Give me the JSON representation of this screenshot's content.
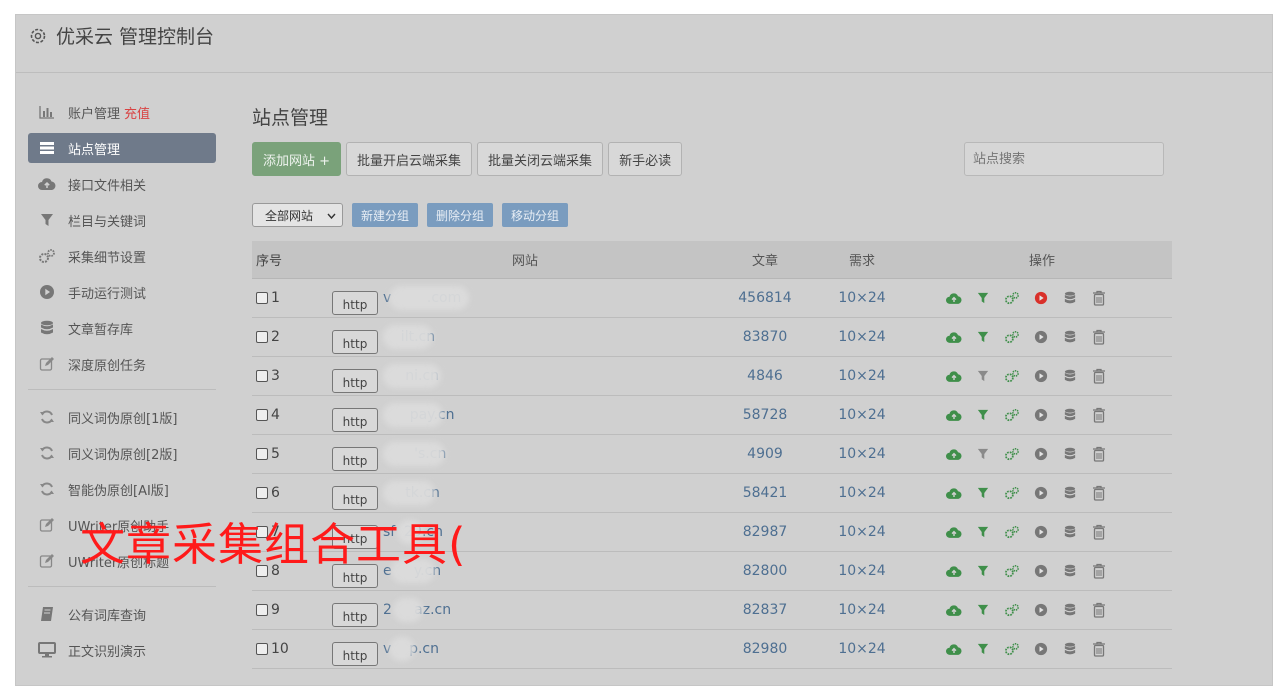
{
  "header": {
    "title": "优采云 管理控制台"
  },
  "sidebar": {
    "items": [
      {
        "label": "账户管理",
        "badge": "充值",
        "icon": "bar-chart-icon"
      },
      {
        "label": "站点管理",
        "icon": "list-icon",
        "active": true
      },
      {
        "label": "接口文件相关",
        "icon": "cloud-upload-icon"
      },
      {
        "label": "栏目与关键词",
        "icon": "filter-icon"
      },
      {
        "label": "采集细节设置",
        "icon": "gears-icon"
      },
      {
        "label": "手动运行测试",
        "icon": "play-circle-icon"
      },
      {
        "label": "文章暂存库",
        "icon": "database-icon"
      },
      {
        "label": "深度原创任务",
        "icon": "edit-icon"
      }
    ],
    "items2": [
      {
        "label": "同义词伪原创[1版]",
        "icon": "refresh-icon"
      },
      {
        "label": "同义词伪原创[2版]",
        "icon": "refresh-icon"
      },
      {
        "label": "智能伪原创[AI版]",
        "icon": "refresh-icon"
      },
      {
        "label": "UWriter原创助手",
        "icon": "edit-icon"
      },
      {
        "label": "UWriter原创标题",
        "icon": "edit-icon"
      }
    ],
    "items3": [
      {
        "label": "公有词库查询",
        "icon": "book-icon"
      },
      {
        "label": "正文识别演示",
        "icon": "monitor-icon"
      }
    ]
  },
  "main": {
    "title": "站点管理",
    "toolbar": {
      "add": "添加网站 +",
      "enable_all": "批量开启云端采集",
      "disable_all": "批量关闭云端采集",
      "guide": "新手必读"
    },
    "search_placeholder": "站点搜索",
    "group_select": "全部网站",
    "group_buttons": {
      "new": "新建分组",
      "delete": "删除分组",
      "move": "移动分组"
    },
    "table": {
      "headers": {
        "no": "序号",
        "site": "网站",
        "articles": "文章",
        "demand": "需求",
        "ops": "操作"
      },
      "rows": [
        {
          "no": "1",
          "scheme": "http",
          "host": "v        .com",
          "articles": "456814",
          "demand": "10×24",
          "run_active": true,
          "filter_dim": false
        },
        {
          "no": "2",
          "scheme": "http",
          "host": "    ilt.cn",
          "articles": "83870",
          "demand": "10×24",
          "run_active": false,
          "filter_dim": false
        },
        {
          "no": "3",
          "scheme": "http",
          "host": "     ni.cn",
          "articles": "4846",
          "demand": "10×24",
          "run_active": false,
          "filter_dim": true
        },
        {
          "no": "4",
          "scheme": "http",
          "host": "      pay.cn",
          "articles": "58728",
          "demand": "10×24",
          "run_active": false,
          "filter_dim": false
        },
        {
          "no": "5",
          "scheme": "http",
          "host": "       's.cn",
          "articles": "4909",
          "demand": "10×24",
          "run_active": false,
          "filter_dim": true
        },
        {
          "no": "6",
          "scheme": "http",
          "host": "     tk.cn",
          "articles": "58421",
          "demand": "10×24",
          "run_active": false,
          "filter_dim": false
        },
        {
          "no": "7",
          "scheme": "http",
          "host": "sf  29.cn",
          "articles": "82987",
          "demand": "10×24",
          "run_active": false,
          "filter_dim": false
        },
        {
          "no": "8",
          "scheme": "http",
          "host": "e     y.cn",
          "articles": "82800",
          "demand": "10×24",
          "run_active": false,
          "filter_dim": false
        },
        {
          "no": "9",
          "scheme": "http",
          "host": "2     az.cn",
          "articles": "82837",
          "demand": "10×24",
          "run_active": false,
          "filter_dim": false
        },
        {
          "no": "10",
          "scheme": "http",
          "host": "v    p.cn",
          "articles": "82980",
          "demand": "10×24",
          "run_active": false,
          "filter_dim": false
        }
      ]
    }
  },
  "overlay": {
    "text": "文章采集组合工具("
  },
  "colors": {
    "accent_green": "#3f8f4a",
    "accent_red": "#d9302a",
    "link": "#4e6f91"
  }
}
